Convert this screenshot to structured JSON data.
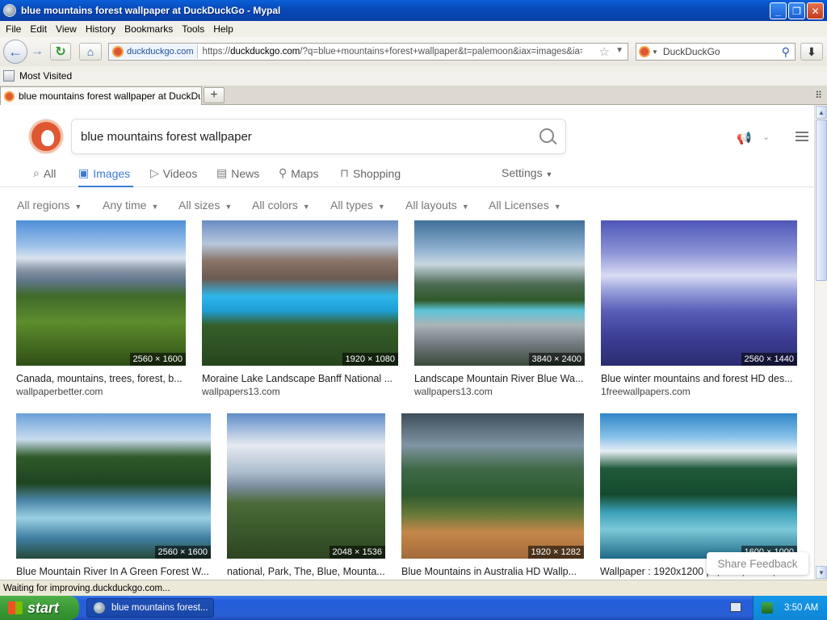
{
  "window": {
    "title": "blue mountains forest wallpaper at DuckDuckGo - Mypal"
  },
  "menu": [
    "File",
    "Edit",
    "View",
    "History",
    "Bookmarks",
    "Tools",
    "Help"
  ],
  "navbar": {
    "identity": "duckduckgo.com",
    "url_prefix": "https://",
    "url_host": "duckduckgo.com",
    "url_rest": "/?q=blue+mountains+forest+wallpaper&t=palemoon&iax=images&ia=image",
    "search_engine": "DuckDuckGo"
  },
  "bookmarks": {
    "most_visited": "Most Visited"
  },
  "tab": {
    "title": "blue mountains forest wallpaper at DuckDuck..."
  },
  "ddg": {
    "query": "blue mountains forest wallpaper",
    "tabs": {
      "all": "All",
      "images": "Images",
      "videos": "Videos",
      "news": "News",
      "maps": "Maps",
      "shopping": "Shopping",
      "settings": "Settings"
    },
    "filters": {
      "regions": "All regions",
      "time": "Any time",
      "sizes": "All sizes",
      "colors": "All colors",
      "types": "All types",
      "layouts": "All layouts",
      "licenses": "All Licenses"
    },
    "results": [
      {
        "title": "Canada, mountains, trees, forest, b...",
        "source": "wallpaperbetter.com",
        "dims": "2560 × 1600"
      },
      {
        "title": "Moraine Lake Landscape Banff National ...",
        "source": "wallpapers13.com",
        "dims": "1920 × 1080"
      },
      {
        "title": "Landscape Mountain River Blue Wa...",
        "source": "wallpapers13.com",
        "dims": "3840 × 2400"
      },
      {
        "title": "Blue winter mountains and forest HD des...",
        "source": "1freewallpapers.com",
        "dims": "2560 × 1440"
      },
      {
        "title": "Blue Mountain River In A Green Forest W...",
        "source": "",
        "dims": "2560 × 1600"
      },
      {
        "title": "national, Park, The, Blue, Mounta...",
        "source": "",
        "dims": "2048 × 1536"
      },
      {
        "title": "Blue Mountains in Australia HD Wallp...",
        "source": "",
        "dims": "1920 × 1282"
      },
      {
        "title": "Wallpaper : 1920x1200 px, blue, forest, l...",
        "source": "",
        "dims": "1600 × 1000"
      }
    ],
    "feedback": "Share Feedback"
  },
  "status": "Waiting for improving.duckduckgo.com...",
  "taskbar": {
    "start": "start",
    "task": "blue mountains forest...",
    "clock": "3:50 AM"
  }
}
